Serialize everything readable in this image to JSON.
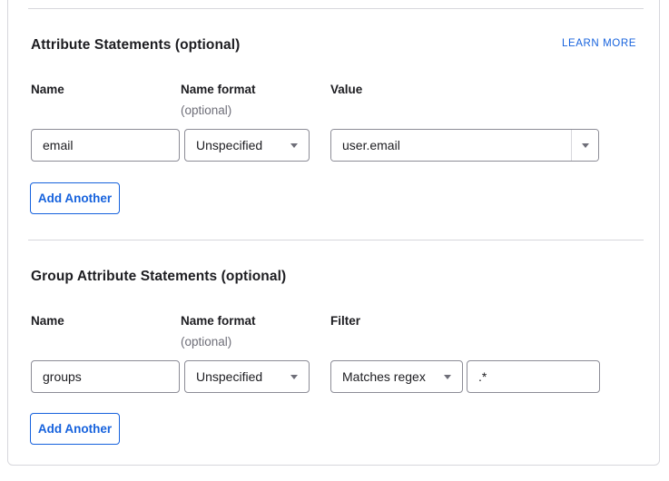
{
  "card": {
    "learn_more": "LEARN MORE",
    "sections": [
      {
        "title": "Attribute Statements (optional)",
        "columns": {
          "name": "Name",
          "name_format": "Name format",
          "name_format_note": "(optional)",
          "col3": "Value"
        },
        "row": {
          "name": "email",
          "name_format": "Unspecified",
          "value": "user.email"
        },
        "add_button": "Add Another"
      },
      {
        "title": "Group Attribute Statements (optional)",
        "columns": {
          "name": "Name",
          "name_format": "Name format",
          "name_format_note": "(optional)",
          "col3": "Filter"
        },
        "row": {
          "name": "groups",
          "name_format": "Unspecified",
          "filter_type": "Matches regex",
          "filter_value": ".*"
        },
        "add_button": "Add Another"
      }
    ]
  },
  "colors": {
    "accent_blue": "#1662dd",
    "input_border": "#8c8c96",
    "divider": "#d7d7dc",
    "text": "#1d1d21",
    "muted_text": "#6e6e78"
  }
}
